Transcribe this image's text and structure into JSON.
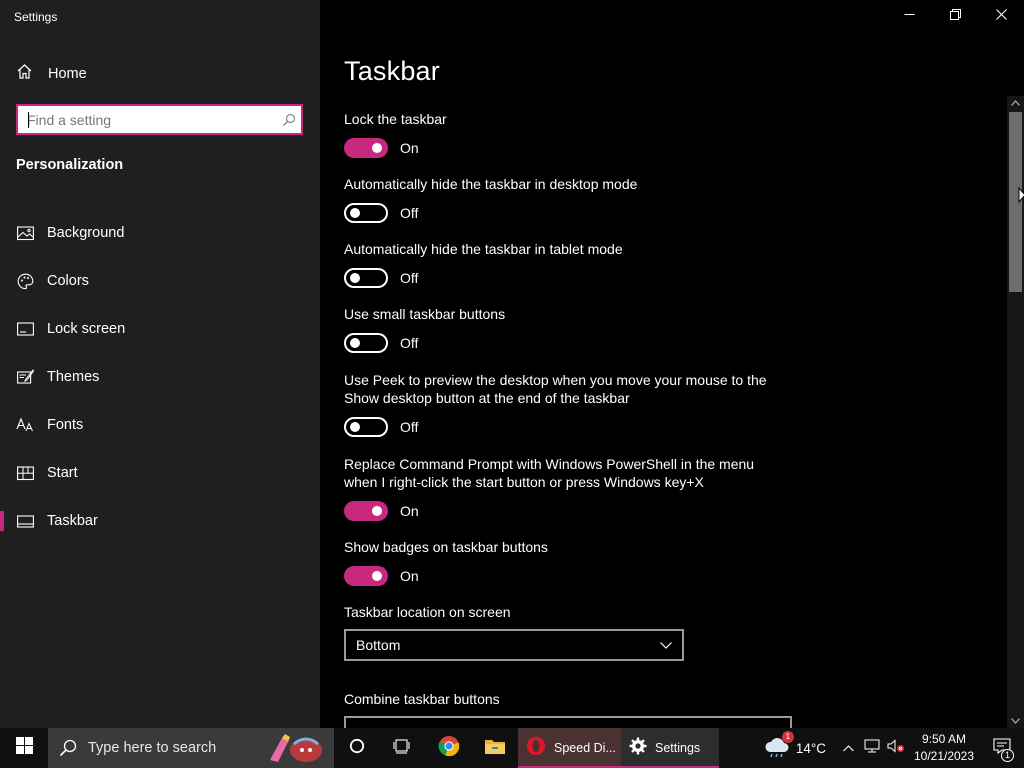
{
  "window": {
    "app_title": "Settings",
    "controls": {
      "minimize": "minimize-icon",
      "restore": "restore-icon",
      "close": "close-icon"
    }
  },
  "sidebar": {
    "home_label": "Home",
    "search_placeholder": "Find a setting",
    "section_title": "Personalization",
    "items": [
      {
        "label": "Background",
        "icon": "picture-icon"
      },
      {
        "label": "Colors",
        "icon": "palette-icon"
      },
      {
        "label": "Lock screen",
        "icon": "lock-screen-icon"
      },
      {
        "label": "Themes",
        "icon": "themes-icon"
      },
      {
        "label": "Fonts",
        "icon": "fonts-icon"
      },
      {
        "label": "Start",
        "icon": "start-icon"
      },
      {
        "label": "Taskbar",
        "icon": "taskbar-icon",
        "active": true
      }
    ]
  },
  "main": {
    "title": "Taskbar",
    "settings": [
      {
        "label": "Lock the taskbar",
        "state": "On"
      },
      {
        "label": "Automatically hide the taskbar in desktop mode",
        "state": "Off"
      },
      {
        "label": "Automatically hide the taskbar in tablet mode",
        "state": "Off"
      },
      {
        "label": "Use small taskbar buttons",
        "state": "Off"
      },
      {
        "label": "Use Peek to preview the desktop when you move your mouse to the Show desktop button at the end of the taskbar",
        "state": "Off"
      },
      {
        "label": "Replace Command Prompt with Windows PowerShell in the menu when I right-click the start button or press Windows key+X",
        "state": "On"
      },
      {
        "label": "Show badges on taskbar buttons",
        "state": "On"
      }
    ],
    "location_label": "Taskbar location on screen",
    "location_value": "Bottom",
    "combine_label": "Combine taskbar buttons"
  },
  "taskbar": {
    "search_text": "Type here to search",
    "apps": {
      "speed_dial": "Speed Di...",
      "settings": "Settings"
    },
    "weather_temp": "14°C",
    "weather_badge": "1",
    "time": "9:50 AM",
    "date": "10/21/2023",
    "notification_count": "1"
  },
  "colors": {
    "accent": "#c8287e",
    "sidebar_bg": "#1f1f1f",
    "main_bg": "#000000"
  }
}
